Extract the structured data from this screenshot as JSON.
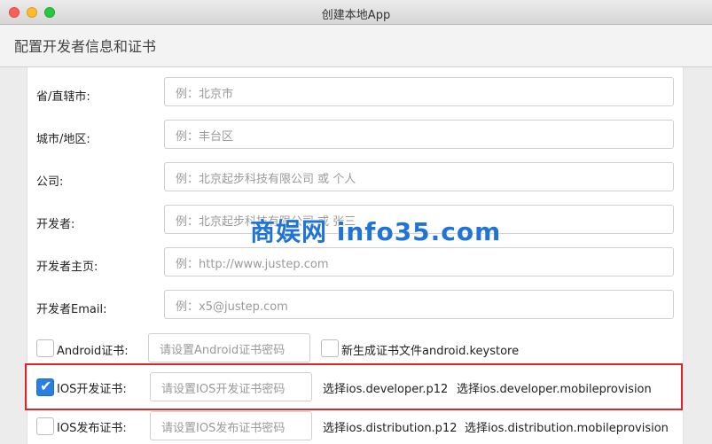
{
  "window": {
    "title": "创建本地App"
  },
  "header": {
    "title": "配置开发者信息和证书"
  },
  "form": {
    "province": {
      "label": "省/直辖市:",
      "placeholder": "例：北京市"
    },
    "city": {
      "label": "城市/地区:",
      "placeholder": "例：丰台区"
    },
    "company": {
      "label": "公司:",
      "placeholder": "例：北京起步科技有限公司 或 个人"
    },
    "developer": {
      "label": "开发者:",
      "placeholder": "例：北京起步科技有限公司 或 张三"
    },
    "homepage": {
      "label": "开发者主页:",
      "placeholder": "例：http://www.justep.com"
    },
    "email": {
      "label": "开发者Email:",
      "placeholder": "例：x5@justep.com"
    }
  },
  "certs": {
    "android": {
      "label": "Android证书:",
      "checked": false,
      "password_placeholder": "请设置Android证书密码",
      "generate_label": "新生成证书文件android.keystore"
    },
    "ios_dev": {
      "label": "IOS开发证书:",
      "checked": true,
      "password_placeholder": "请设置IOS开发证书密码",
      "select_p12": "选择ios.developer.p12",
      "select_provision": "选择ios.developer.mobileprovision"
    },
    "ios_dist": {
      "label": "IOS发布证书:",
      "checked": false,
      "password_placeholder": "请设置IOS发布证书密码",
      "select_p12": "选择ios.distribution.p12",
      "select_provision": "选择ios.distribution.mobileprovision"
    }
  },
  "watermark": {
    "text": "商娱网 info35.com"
  },
  "colors": {
    "accent": "#2a7de1",
    "highlight": "#d9262c",
    "watermark": "#1f74d6"
  }
}
